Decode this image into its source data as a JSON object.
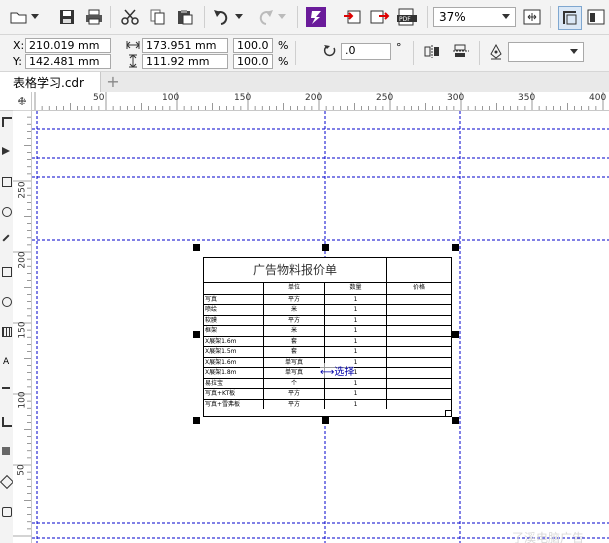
{
  "toolbar": {
    "zoom": "37%",
    "icons": [
      "open-folder-icon",
      "dropdown-arrow-icon",
      "save-icon",
      "print-icon",
      "cut-icon",
      "copy-icon",
      "paste-icon",
      "undo-icon",
      "redo-icon",
      "corel-connect-icon",
      "import-icon",
      "export-icon",
      "publish-pdf-icon",
      "zoom-level-combo",
      "full-screen-icon",
      "snap-icon",
      "options-icon"
    ]
  },
  "property_bar": {
    "x_label": "X:",
    "x_value": "210.019 mm",
    "y_label": "Y:",
    "y_value": "142.481 mm",
    "width_value": "173.951 mm",
    "height_value": "111.92 mm",
    "scale_w": "100.0",
    "scale_h": "100.0",
    "percent1": "%",
    "percent2": "%",
    "rotation": ".0",
    "degree": "°"
  },
  "document_tab": {
    "title": "表格学习.cdr",
    "add_label": "+"
  },
  "ruler": {
    "h_ticks": [
      "50",
      "100",
      "150",
      "200",
      "250",
      "300",
      "350",
      "400"
    ],
    "v_ticks": [
      "250",
      "200",
      "150",
      "100",
      "50"
    ]
  },
  "table": {
    "title": "广告物料报价单",
    "headers": [
      "",
      "单位",
      "数量",
      "价格"
    ],
    "rows": [
      [
        "写真",
        "平方",
        "1"
      ],
      [
        "喷绘",
        "米",
        "1"
      ],
      [
        "软膜",
        "平方",
        "1"
      ],
      [
        "框架",
        "米",
        "1"
      ],
      [
        "X展架1.6m",
        "套",
        "1"
      ],
      [
        "X展架1.5m",
        "套",
        "1"
      ],
      [
        "X展架1.6m",
        "单写真",
        "1"
      ],
      [
        "X展架1.8m",
        "单写真",
        "1"
      ],
      [
        "易拉宝",
        "个",
        "1"
      ],
      [
        "写真+KT板",
        "平方",
        "1"
      ],
      [
        "写真+雪弗板",
        "平方",
        "1"
      ]
    ],
    "cursor_label": "选择"
  },
  "watermark": "了溪电脑广告"
}
